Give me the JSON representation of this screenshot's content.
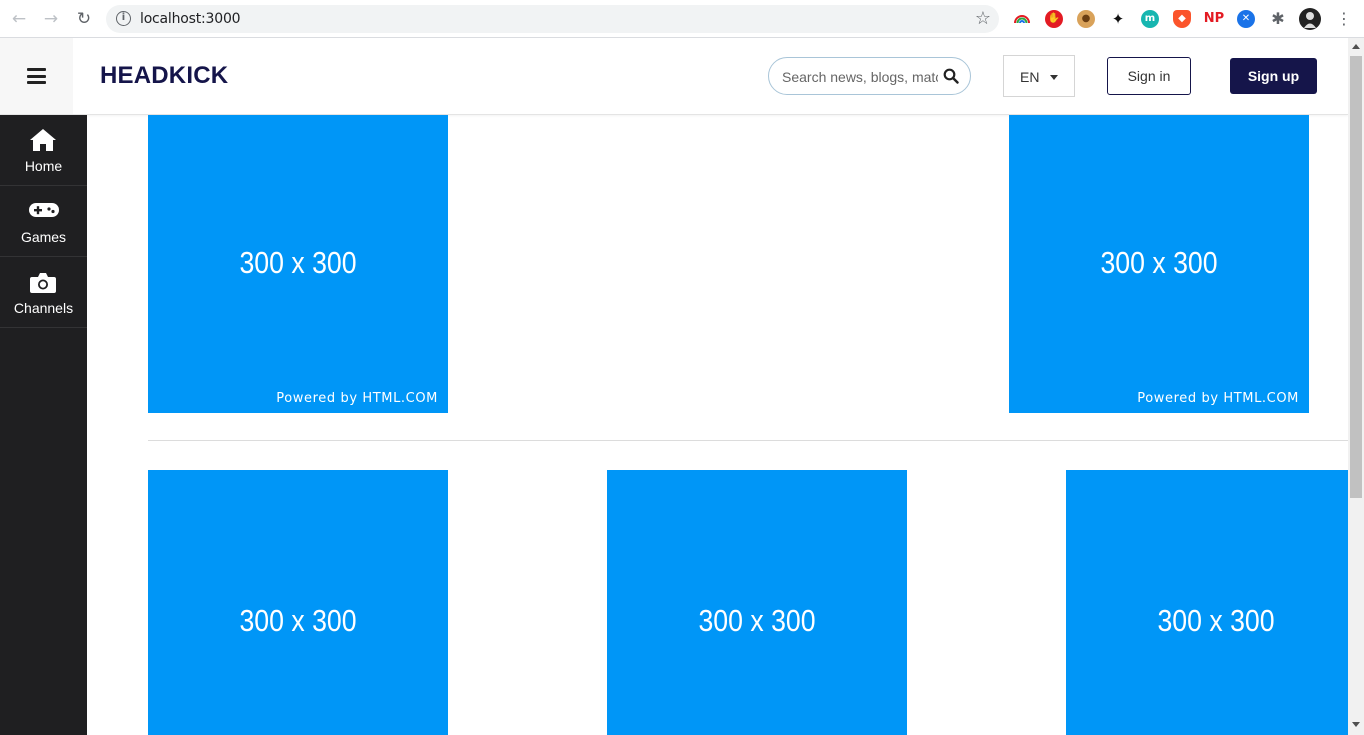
{
  "browser": {
    "url": "localhost:3000",
    "extensions": [
      {
        "name": "rainbow-extension-icon",
        "color": "#f4a300"
      },
      {
        "name": "stop-hand-extension-icon",
        "color": "#e31b23"
      },
      {
        "name": "cookie-extension-icon",
        "color": "#c88a3f"
      },
      {
        "name": "gnome-extension-icon",
        "color": "#111111"
      },
      {
        "name": "m-extension-icon",
        "color": "#17b6b0"
      },
      {
        "name": "shield-extension-icon",
        "color": "#fb542b"
      },
      {
        "name": "np-extension-icon",
        "color": "#e31b23"
      },
      {
        "name": "blue-x-extension-icon",
        "color": "#1a73e8"
      },
      {
        "name": "puzzle-extension-icon",
        "color": "#5f6368"
      },
      {
        "name": "profile-avatar-icon",
        "color": "#222222"
      }
    ],
    "np_text": "NP",
    "m_text": "m"
  },
  "header": {
    "brand": "HEADKICK",
    "search_placeholder": "Search news, blogs, matches",
    "language": "EN",
    "signin_label": "Sign in",
    "signup_label": "Sign up",
    "brand_color": "#15154a"
  },
  "sidebar": {
    "items": [
      {
        "label": "Home",
        "icon": "home-icon"
      },
      {
        "label": "Games",
        "icon": "gamepad-icon"
      },
      {
        "label": "Channels",
        "icon": "camera-icon"
      }
    ]
  },
  "ads": {
    "size_text": "300 x 300",
    "powered_text": "Powered by HTML.COM",
    "color": "#0096f7"
  }
}
